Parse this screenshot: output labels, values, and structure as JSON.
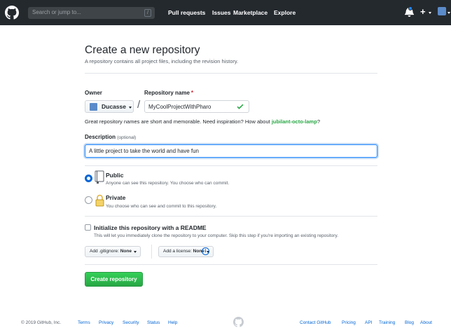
{
  "header": {
    "search_placeholder": "Search or jump to...",
    "search_shortcut": "/",
    "nav": [
      "Pull requests",
      "Issues",
      "Marketplace",
      "Explore"
    ]
  },
  "page": {
    "title": "Create a new repository",
    "subtitle": "A repository contains all project files, including the revision history."
  },
  "form": {
    "owner_label": "Owner",
    "repo_name_label": "Repository name",
    "required_mark": "*",
    "owner_value": "Ducasse",
    "separator": "/",
    "repo_name_value": "MyCoolProjectWithPharo",
    "hint_text": "Great repository names are short and memorable. Need inspiration? How about ",
    "hint_suggestion": "jubilant-octo-lamp",
    "hint_end": "?",
    "description_label": "Description",
    "description_optional": "(optional)",
    "description_value": "A little project to take the world and have fun",
    "visibility": {
      "public_title": "Public",
      "public_desc": "Anyone can see this repository. You choose who can commit.",
      "private_title": "Private",
      "private_desc": "You choose who can see and commit to this repository.",
      "selected": "public"
    },
    "init_readme_title": "Initialize this repository with a README",
    "init_readme_desc": "This will let you immediately clone the repository to your computer. Skip this step if you're importing an existing repository.",
    "gitignore_prefix": "Add .gitignore:",
    "gitignore_value": "None",
    "license_prefix": "Add a license:",
    "license_value": "None",
    "info_glyph": "i",
    "submit_label": "Create repository"
  },
  "footer": {
    "copyright": "© 2019 GitHub, Inc.",
    "left_links": [
      "Terms",
      "Privacy",
      "Security",
      "Status",
      "Help"
    ],
    "right_links": [
      "Contact GitHub",
      "Pricing",
      "API",
      "Training",
      "Blog",
      "About"
    ]
  },
  "colors": {
    "header_bg": "#24292e",
    "link": "#0366d6",
    "success": "#28a745",
    "required": "#cb2431"
  }
}
